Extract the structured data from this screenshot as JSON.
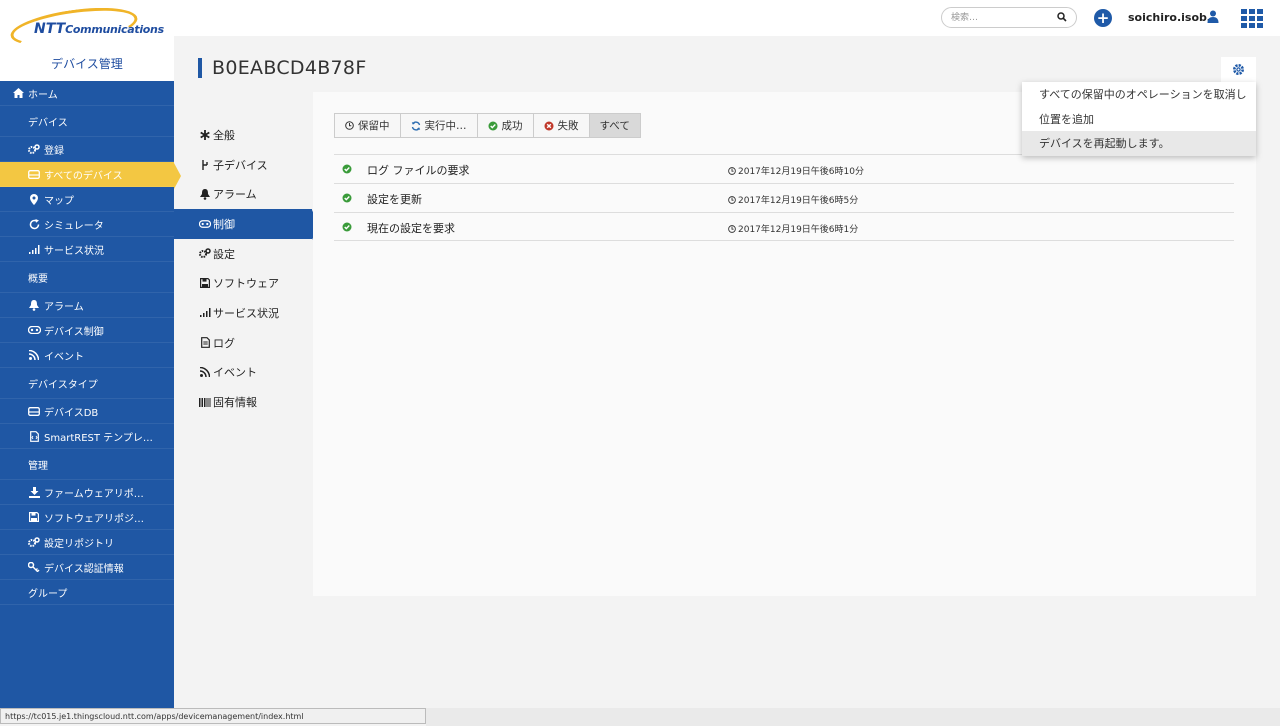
{
  "topbar": {
    "search_placeholder": "検索…",
    "username": "soichiro.isob…"
  },
  "brand": {
    "logo_ntt": "NTT",
    "logo_communications": "Communications",
    "app_name": "デバイス管理"
  },
  "sidebar": {
    "home": "ホーム",
    "section_device": "デバイス",
    "register": "登録",
    "all_devices": "すべてのデバイス",
    "map": "マップ",
    "simulator": "シミュレータ",
    "service_status": "サービス状況",
    "section_overview": "概要",
    "alarm": "アラーム",
    "device_control": "デバイス制御",
    "event": "イベント",
    "section_device_type": "デバイスタイプ",
    "device_db": "デバイスDB",
    "smartrest": "SmartREST テンプレ…",
    "section_admin": "管理",
    "firmware_repo": "ファームウェアリポ…",
    "software_repo": "ソフトウェアリポジ…",
    "config_repo": "設定リポジトリ",
    "device_credentials": "デバイス認証情報",
    "group": "グループ"
  },
  "device": {
    "id": "B0EABCD4B78F"
  },
  "subnav": {
    "general": "全般",
    "child_devices": "子デバイス",
    "alarm": "アラーム",
    "control": "制御",
    "config": "設定",
    "software": "ソフトウェア",
    "service_status": "サービス状況",
    "log": "ログ",
    "event": "イベント",
    "identity": "固有情報"
  },
  "filters": {
    "pending": "保留中",
    "executing": "実行中…",
    "success": "成功",
    "failed": "失敗",
    "all": "すべて"
  },
  "operations": [
    {
      "name": "ログ ファイルの要求",
      "time": "2017年12月19日午後6時10分",
      "status": "success"
    },
    {
      "name": "設定を更新",
      "time": "2017年12月19日午後6時5分",
      "status": "success"
    },
    {
      "name": "現在の設定を要求",
      "time": "2017年12月19日午後6時1分",
      "status": "success"
    }
  ],
  "dropdown": {
    "cancel_all_pending": "すべての保留中のオペレーションを取消し",
    "add_location": "位置を追加",
    "restart_device": "デバイスを再起動します。"
  },
  "statusbar": {
    "url": "https://tc015.je1.thingscloud.ntt.com/apps/devicemanagement/index.html"
  },
  "colors": {
    "sidebar_bg": "#1f57a4",
    "active_yellow": "#f3c742",
    "success_green": "#3a9b3a",
    "failed_red": "#c0392b"
  }
}
